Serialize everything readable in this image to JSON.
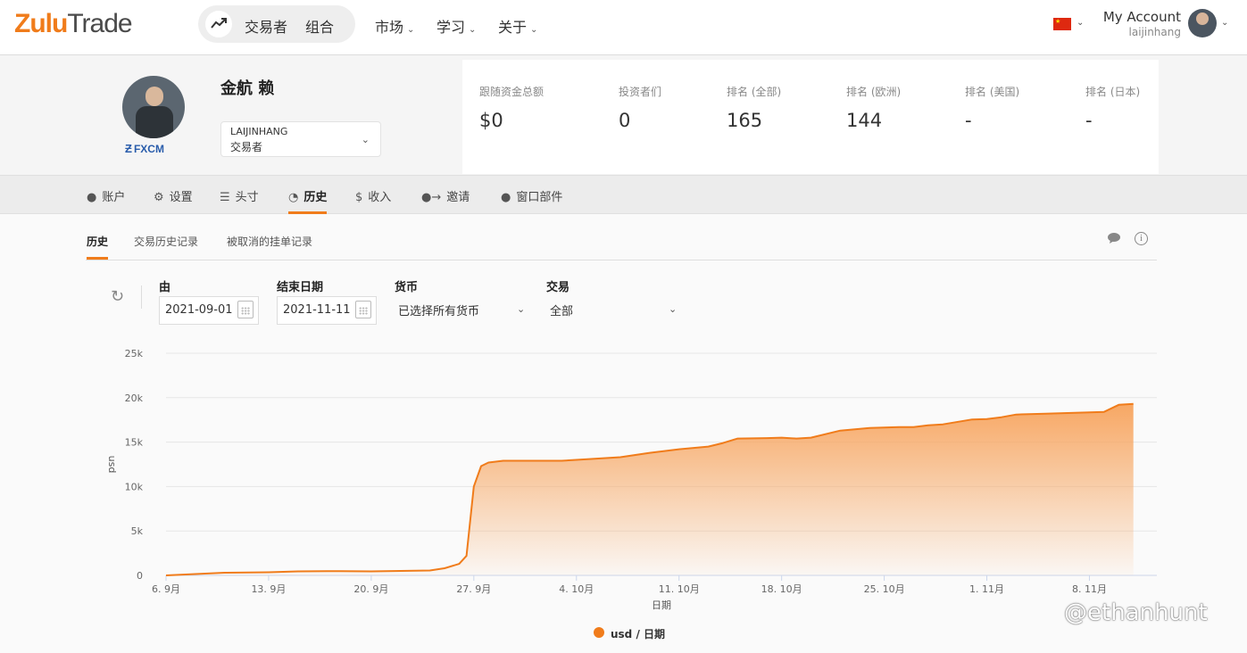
{
  "header": {
    "logo_zulu": "Zulu",
    "logo_trade": "Trade",
    "pill_item1": "交易者",
    "pill_item2": "组合",
    "nav": [
      "市场",
      "学习",
      "关于"
    ],
    "account_label": "My Account",
    "username": "laijinhang",
    "chevron": "⌄"
  },
  "profile": {
    "name": "金航 赖",
    "broker": "FXCM",
    "select_line1": "LAIJINHANG",
    "select_line2": "交易者",
    "stats": [
      {
        "label": "跟随资金总额",
        "value": "$0"
      },
      {
        "label": "投资者们",
        "value": "0"
      },
      {
        "label": "排名 (全部)",
        "value": "165"
      },
      {
        "label": "排名 (欧洲)",
        "value": "144"
      },
      {
        "label": "排名 (美国)",
        "value": "-"
      },
      {
        "label": "排名 (日本)",
        "value": "-"
      }
    ]
  },
  "tabs": [
    {
      "label": "账户",
      "icon": "user-icon"
    },
    {
      "label": "设置",
      "icon": "gear-icon"
    },
    {
      "label": "头寸",
      "icon": "list-icon"
    },
    {
      "label": "历史",
      "icon": "clock-icon",
      "active": true
    },
    {
      "label": "收入",
      "icon": "dollar-icon"
    },
    {
      "label": "邀请",
      "icon": "invite-icon"
    },
    {
      "label": "窗口部件",
      "icon": "widget-icon"
    }
  ],
  "subtabs": [
    "历史",
    "交易历史记录",
    "被取消的挂单记录"
  ],
  "filters": {
    "from_label": "由",
    "from_value": "2021-09-01",
    "to_label": "结束日期",
    "to_value": "2021-11-11",
    "currency_label": "货币",
    "currency_value": "已选择所有货币",
    "trade_label": "交易",
    "trade_value": "全部"
  },
  "chart_data": {
    "type": "area",
    "xlabel": "日期",
    "ylabel": "usd",
    "ylim": [
      0,
      25000
    ],
    "yticks": [
      "0",
      "5k",
      "10k",
      "15k",
      "20k",
      "25k"
    ],
    "xticks": [
      "6. 9月",
      "13. 9月",
      "20. 9月",
      "27. 9月",
      "4. 10月",
      "11. 10月",
      "18. 10月",
      "25. 10月",
      "1. 11月",
      "8. 11月"
    ],
    "x_day_start": "2021-09-06",
    "series": [
      {
        "name": "usd / 日期",
        "color": "#f07c1b",
        "x": [
          "2021-09-06",
          "2021-09-08",
          "2021-09-10",
          "2021-09-13",
          "2021-09-15",
          "2021-09-17",
          "2021-09-20",
          "2021-09-22",
          "2021-09-24",
          "2021-09-25",
          "2021-09-26",
          "2021-09-26T12",
          "2021-09-27",
          "2021-09-27T12",
          "2021-09-28",
          "2021-09-29",
          "2021-10-01",
          "2021-10-03",
          "2021-10-05",
          "2021-10-07",
          "2021-10-09",
          "2021-10-11",
          "2021-10-13",
          "2021-10-14",
          "2021-10-15",
          "2021-10-17",
          "2021-10-18",
          "2021-10-19",
          "2021-10-20",
          "2021-10-22",
          "2021-10-24",
          "2021-10-26",
          "2021-10-27",
          "2021-10-28",
          "2021-10-29",
          "2021-10-31",
          "2021-11-01",
          "2021-11-02",
          "2021-11-03",
          "2021-11-05",
          "2021-11-07",
          "2021-11-09",
          "2021-11-10",
          "2021-11-11"
        ],
        "values": [
          0,
          150,
          300,
          350,
          450,
          480,
          450,
          500,
          550,
          800,
          1300,
          2200,
          10000,
          12300,
          12700,
          12900,
          12900,
          12900,
          13100,
          13300,
          13800,
          14200,
          14500,
          14900,
          15400,
          15450,
          15500,
          15400,
          15500,
          16300,
          16600,
          16700,
          16700,
          16900,
          17000,
          17550,
          17600,
          17800,
          18100,
          18200,
          18300,
          18400,
          19200,
          19300
        ]
      }
    ]
  },
  "legend": "usd / 日期",
  "watermark": "@ethanhunt"
}
